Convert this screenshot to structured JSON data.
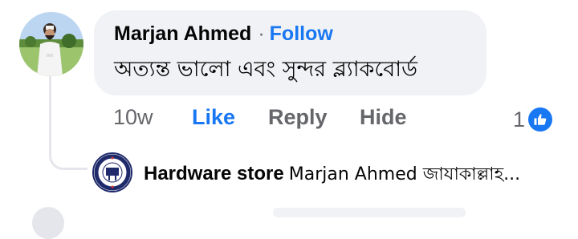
{
  "comment": {
    "author": "Marjan Ahmed",
    "separator": "·",
    "follow_label": "Follow",
    "text": "অত্যন্ত ভালো এবং সুন্দর ব্ল্যাকবোর্ড",
    "avatar_icon": "profile-photo-man-outdoors",
    "actions": {
      "time": "10w",
      "like_label": "Like",
      "reply_label": "Reply",
      "hide_label": "Hide"
    },
    "reaction": {
      "count": "1",
      "icon": "like-thumb-icon"
    }
  },
  "reply": {
    "author": "Hardware store",
    "text": "Marjan Ahmed জাযাকাল্লাহ...",
    "avatar_icon": "hardware-store-logo"
  },
  "colors": {
    "accent": "#1877f2",
    "bubble": "#f0f2f5",
    "secondary_text": "#65676b",
    "primary_text": "#050505"
  }
}
